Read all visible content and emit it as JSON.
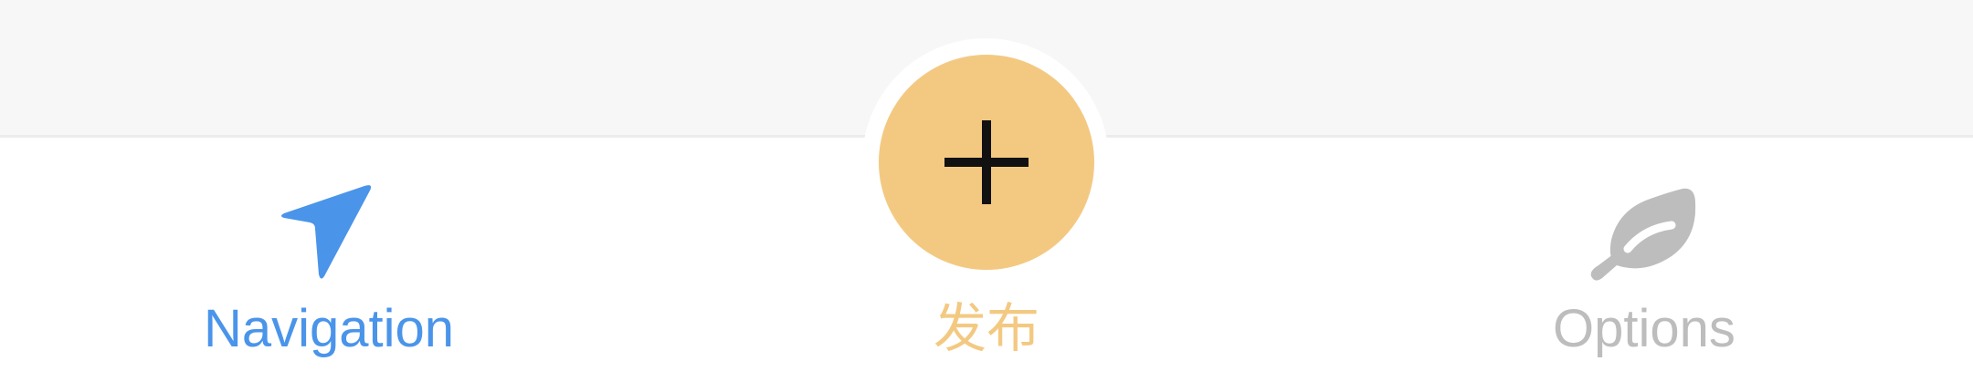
{
  "colors": {
    "background_top": "#f7f7f7",
    "tab_bar": "#ffffff",
    "active_blue": "#4a94ea",
    "publish_yellow": "#f3c982",
    "inactive_gray": "#bdbdbd"
  },
  "tabs": [
    {
      "label": "Navigation",
      "icon": "navigation-arrow-icon",
      "state": "active"
    },
    {
      "label": "发布",
      "icon": "plus-icon",
      "state": "center"
    },
    {
      "label": "Options",
      "icon": "leaf-icon",
      "state": "inactive"
    }
  ]
}
